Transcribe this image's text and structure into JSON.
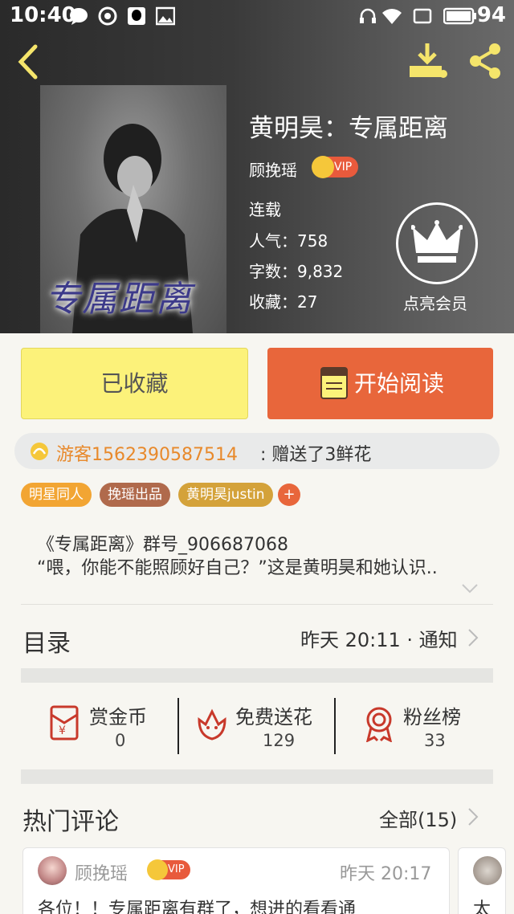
{
  "status_bar": {
    "time": "10:40",
    "battery": "94"
  },
  "colors": {
    "accent_orange": "#e8663b",
    "collected_yellow": "#fcf27a",
    "gift_user": "#e8892b",
    "vip_red": "#e85a3c",
    "crown_gold": "#f5c73a"
  },
  "book": {
    "cover_title": "专属距离",
    "title": "黄明昊：专属距离",
    "author": "顾挽瑶",
    "vip": "VIP",
    "status": "连载",
    "popularity": "人气：758",
    "word_count": "字数：9,832",
    "favorites": "收藏：27",
    "member_label": "点亮会员"
  },
  "actions": {
    "collected": "已收藏",
    "read": "开始阅读"
  },
  "gift": {
    "user": "游客1562390587514",
    "text": ": 赠送了3鲜花"
  },
  "tags": [
    "明星同人",
    "挽瑶出品",
    "黄明昊justin"
  ],
  "tag_add": "+",
  "description": [
    "《专属距离》群号_906687068",
    "“喂，你能不能照顾好自己？”这是黄明昊和她认识.."
  ],
  "catalog": {
    "title": "目录",
    "update": "昨天 20:11 · 通知"
  },
  "stats": [
    {
      "label": "赏金币",
      "value": "0",
      "icon": "red-envelope-icon"
    },
    {
      "label": "免费送花",
      "value": "129",
      "icon": "flower-icon"
    },
    {
      "label": "粉丝榜",
      "value": "33",
      "icon": "medal-icon"
    }
  ],
  "comments_section": {
    "title": "热门评论",
    "all": "全部(15)"
  },
  "comments": [
    {
      "name": "顾挽瑶",
      "vip": "VIP",
      "time": "昨天 20:17",
      "text": "各位！！专属距离有群了，想进的看看通"
    },
    {
      "text": "太"
    }
  ]
}
